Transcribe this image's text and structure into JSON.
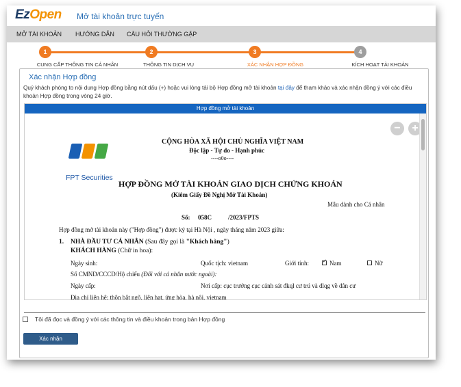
{
  "header": {
    "logo_ez": "Ez",
    "logo_open": "Open",
    "title": "Mở tài khoản trực tuyến"
  },
  "nav": {
    "items": [
      "MỞ TÀI KHOẢN",
      "HƯỚNG DẪN",
      "CÂU HỎI THƯỜNG GẶP"
    ]
  },
  "stepper": {
    "steps": [
      {
        "number": "1",
        "label": "CUNG CẤP THÔNG TIN CÁ NHÂN"
      },
      {
        "number": "2",
        "label": "THÔNG TIN DỊCH VỤ"
      },
      {
        "number": "3",
        "label": "XÁC NHẬN HỢP ĐỒNG"
      },
      {
        "number": "4",
        "label": "KÍCH HOẠT TÀI KHOẢN"
      }
    ],
    "current_step": 3,
    "colors": {
      "active": "#f07b22",
      "inactive": "#9e9e9e"
    }
  },
  "panel": {
    "title": "Xác nhận Hợp đồng",
    "instructions_pre": "Quý khách phóng to nội dung Hợp đồng bằng nút dấu (+) hoặc vui lòng tải bộ Hợp đồng mở tài khoản ",
    "instructions_link": "tại đây",
    "instructions_post": " để tham khảo và xác nhận đồng ý với các điều khoản Hợp đồng trong vòng 24 giờ."
  },
  "contract": {
    "header": "Hợp đồng mở tài khoản",
    "zoom_out": "−",
    "zoom_in": "+",
    "logo_text": "FPT Securities",
    "national_title": "CỘNG HÒA XÃ HỘI CHỦ NGHĨA VIỆT NAM",
    "motto": "Độc lập - Tự do - Hạnh phúc",
    "separator": "----o0o----",
    "doc_title": "HỢP ĐỒNG MỞ TÀI KHOẢN GIAO DỊCH CHỨNG KHOÁN",
    "doc_subtitle": "(Kiêm Giấy Đề Nghị Mở Tài Khoản)",
    "template_note": "Mẫu dành cho Cá nhân",
    "number_label": "Số:",
    "number_value": "058C",
    "number_suffix": "/2023/FPTS",
    "intro": "Hợp đồng mở tài khoản này (\"Hợp đồng\") được ký tại Hà Nội , ngày        tháng    năm 2023 giữa:",
    "section1_num": "1.",
    "section1_title": "NHÀ ĐẦU TƯ CÁ NHÂN",
    "section1_note_pre": " (Sau đây gọi là ",
    "section1_note_bold": "\"Khách hàng\"",
    "section1_note_post": ")",
    "customer_label": "KHÁCH HÀNG",
    "customer_note": " (Chữ in hoa):",
    "dob_label": "Ngày sinh:",
    "nationality_label": "Quốc tịch: vietnam",
    "gender_label": "Giới tính:",
    "gender_male": "Nam",
    "gender_female": "Nữ",
    "id_label": "Số CMND/CCCD/Hộ chiếu ",
    "id_note": "(Đối với cá nhân nước ngoài):",
    "issue_date_label": "Ngày cấp:",
    "issue_place_label": "Nơi cấp: cục trưởng cục cảnh sát đkql cư trú và dlqg về dân cư",
    "address_label": "Địa chỉ liên hệ: thôn bắt ngõ, liên hạt, ứng hòa, hà nội, vietnam"
  },
  "agreement": {
    "text": "Tôi đã đọc và đồng ý với các thông tin và điều khoản trong bản Hợp đồng",
    "checked": false
  },
  "actions": {
    "confirm_label": "Xác nhận"
  },
  "colors": {
    "brand_blue": "#1565c0",
    "accent_orange": "#f07b22",
    "button_blue": "#2f5c8a"
  }
}
